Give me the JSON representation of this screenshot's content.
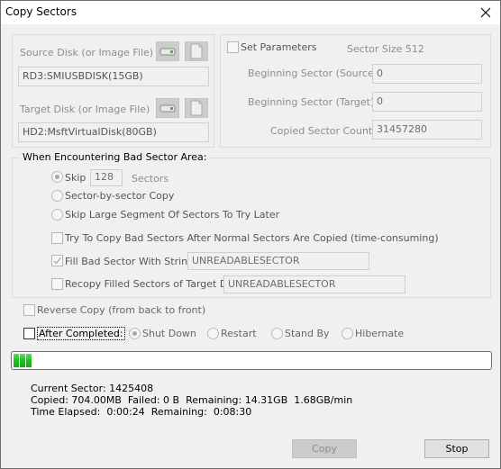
{
  "window": {
    "title": "Copy Sectors",
    "close_icon": "close-icon"
  },
  "disks": {
    "source_label": "Source Disk (or Image File)",
    "source_value": "RD3:SMIUSBDISK(15GB)",
    "target_label": "Target Disk (or Image File)",
    "target_value": "HD2:MsftVirtualDisk(80GB)",
    "disk_icon": "disk-drive-icon",
    "file_icon": "file-icon"
  },
  "parameters": {
    "set_label": "Set Parameters",
    "set_checked": false,
    "sector_size": "Sector Size 512",
    "begin_source_label": "Beginning Sector (Source):",
    "begin_source_value": "0",
    "begin_target_label": "Beginning Sector (Target):",
    "begin_target_value": "0",
    "count_label": "Copied Sector Count:",
    "count_value": "31457280"
  },
  "bad_sector": {
    "group_label": "When Encountering Bad Sector Area:",
    "skip_label": "Skip",
    "skip_value": "128",
    "skip_unit": "Sectors",
    "sector_by_sector_label": "Sector-by-sector Copy",
    "skip_large_label": "Skip Large Segment Of Sectors To Try Later",
    "selected_option": "Skip",
    "try_copy_label": "Try To Copy Bad Sectors After Normal Sectors Are Copied (time-consuming)",
    "try_copy_checked": false,
    "fill_label": "Fill Bad Sector With Strings:",
    "fill_checked": true,
    "fill_value": "UNREADABLESECTOR",
    "recopy_label": "Recopy Filled Sectors of Target Disk:",
    "recopy_checked": false,
    "recopy_value": "UNREADABLESECTOR"
  },
  "options": {
    "reverse_label": "Reverse Copy (from back to front)",
    "reverse_checked": false,
    "after_label": "After Completed:",
    "after_checked": false,
    "after_actions": [
      "Shut Down",
      "Restart",
      "Stand By",
      "Hibernate"
    ],
    "after_selected": "Shut Down"
  },
  "progress": {
    "percent": 4.6,
    "color": "#1ec21e"
  },
  "status": {
    "current_sector": "Current Sector: 1425408",
    "copied_line": "Copied: 704.00MB  Failed: 0 B  Remaining: 14.31GB  1.68GB/min",
    "time_line": "Time Elapsed:  0:00:24  Remaining:  0:08:30"
  },
  "buttons": {
    "copy": "Copy",
    "stop": "Stop"
  }
}
